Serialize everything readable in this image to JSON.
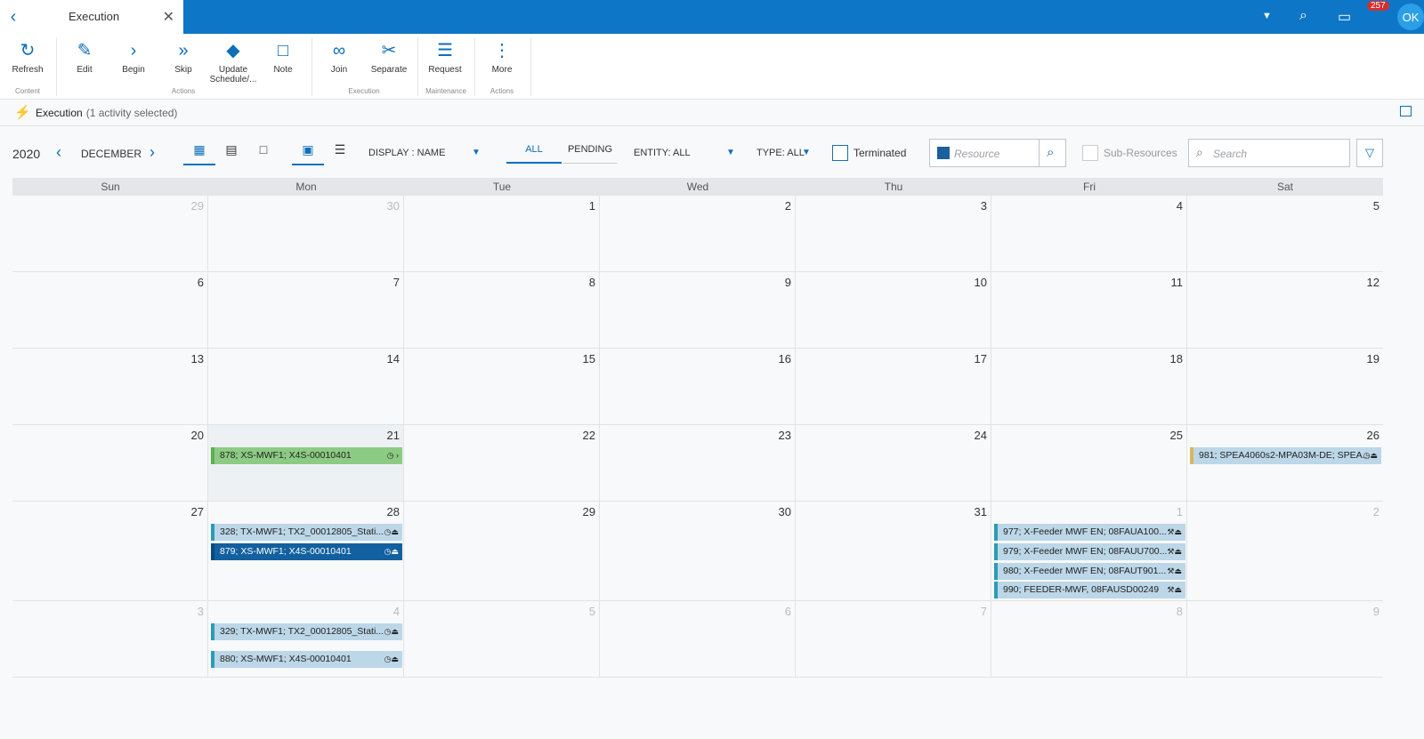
{
  "tab": {
    "title": "Execution"
  },
  "header": {
    "badge_count": "257",
    "avatar": "OK"
  },
  "ribbon": {
    "buttons": [
      {
        "label": "Refresh",
        "icon": "refresh-icon"
      },
      {
        "label": "Edit",
        "icon": "pencil-icon"
      },
      {
        "label": "Begin",
        "icon": "chevron-right-icon"
      },
      {
        "label": "Skip",
        "icon": "double-chevron-icon"
      },
      {
        "label": "Update Schedule/...",
        "icon": "updown-icon"
      },
      {
        "label": "Note",
        "icon": "note-icon"
      },
      {
        "label": "Join",
        "icon": "link-icon"
      },
      {
        "label": "Separate",
        "icon": "unlink-icon"
      },
      {
        "label": "Request",
        "icon": "document-icon"
      },
      {
        "label": "More",
        "icon": "more-vertical-icon"
      }
    ],
    "groups": [
      "Content",
      "Actions",
      "Execution",
      "Maintenance",
      "Actions"
    ]
  },
  "subhead": {
    "title": "Execution",
    "selection": "(1 activity selected)"
  },
  "toolbar": {
    "year": "2020",
    "month": "DECEMBER",
    "display": "DISPLAY : NAME",
    "filter_all": "ALL",
    "filter_pending": "PENDING",
    "entity": "ENTITY: ALL",
    "type": "TYPE: ALL",
    "terminated": "Terminated",
    "resource_placeholder": "Resource",
    "subresources": "Sub-Resources",
    "search_placeholder": "Search"
  },
  "calendar": {
    "weekdays": [
      "Sun",
      "Mon",
      "Tue",
      "Wed",
      "Thu",
      "Fri",
      "Sat"
    ],
    "weeks": [
      [
        "29",
        "30",
        "1",
        "2",
        "3",
        "4",
        "5"
      ],
      [
        "6",
        "7",
        "8",
        "9",
        "10",
        "11",
        "12"
      ],
      [
        "13",
        "14",
        "15",
        "16",
        "17",
        "18",
        "19"
      ],
      [
        "20",
        "21",
        "22",
        "23",
        "24",
        "25",
        "26"
      ],
      [
        "27",
        "28",
        "29",
        "30",
        "31",
        "1",
        "2"
      ],
      [
        "3",
        "4",
        "5",
        "6",
        "7",
        "8",
        "9"
      ]
    ],
    "events": {
      "w3_mon": "878; XS-MWF1; X4S-00010401",
      "w3_sat": "981; SPEA4060s2-MPA03M-DE; SPEA...",
      "w4_mon_1": "328; TX-MWF1; TX2_00012805_Stati...",
      "w4_mon_2": "879; XS-MWF1; X4S-00010401",
      "w4_fri_1": "977; X-Feeder MWF EN; 08FAUA100...",
      "w4_fri_2": "979; X-Feeder MWF EN; 08FAUU700...",
      "w4_fri_3": "980; X-Feeder MWF EN; 08FAUT901...",
      "w4_fri_4": "990; FEEDER-MWF, 08FAUSD00249",
      "w5_mon_1": "329; TX-MWF1; TX2_00012805_Stati...",
      "w5_mon_2": "880; XS-MWF1; X4S-00010401"
    }
  }
}
